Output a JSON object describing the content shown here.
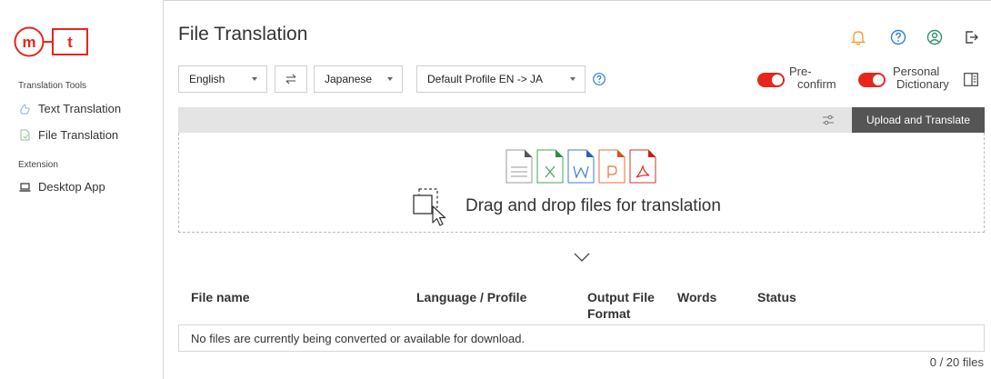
{
  "sidebar": {
    "section_tools": "Translation Tools",
    "items": [
      {
        "label": "Text Translation"
      },
      {
        "label": "File Translation"
      }
    ],
    "section_extension": "Extension",
    "extension_items": [
      {
        "label": "Desktop App"
      }
    ]
  },
  "header": {
    "title": "File Translation",
    "icons": [
      "bell-icon",
      "help-icon",
      "account-icon",
      "logout-icon"
    ]
  },
  "toolbar": {
    "source_language": "English",
    "target_language": "Japanese",
    "profile": "Default Profile EN -> JA",
    "preconfirm_label_1": "Pre-",
    "preconfirm_label_2": "confirm",
    "preconfirm_on": true,
    "dictionary_label_1": "Personal",
    "dictionary_label_2": "Dictionary",
    "dictionary_on": true
  },
  "upload": {
    "button_label": "Upload and Translate",
    "drop_text": "Drag and drop files for translation",
    "file_types": [
      "txt",
      "xlsx",
      "docx",
      "pptx",
      "pdf"
    ]
  },
  "table": {
    "columns": [
      "File name",
      "Language / Profile",
      "Output File",
      "Format",
      "Words",
      "Status"
    ],
    "empty_message": "No files are currently being converted or available for download.",
    "count": "0 / 20 files"
  },
  "colors": {
    "brand_red": "#e8251c",
    "bell_orange": "#f2a13a",
    "link_blue": "#2f7fd6"
  }
}
